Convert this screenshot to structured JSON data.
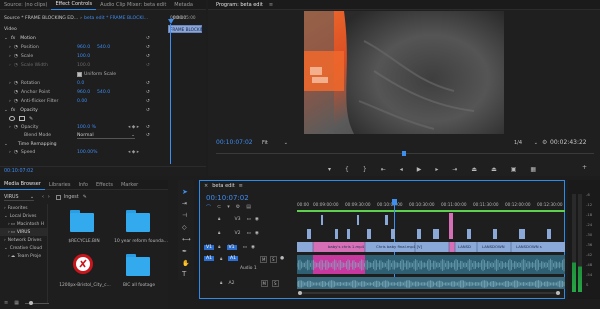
{
  "effect_controls": {
    "tabs": [
      "Source: (no clips)",
      "Effect Controls",
      "Audio Clip Mixer: beta edit",
      "Metada"
    ],
    "source_label": "Source * FRAME BLOCKING ED...",
    "sequence_label": "beta edit * FRAME BLOCKI...",
    "timecode_start": "00:00",
    "timecode_end": "00:00:05:00",
    "clip_label": "FRAME BLOCKING ED",
    "video_header": "Video",
    "motion_label": "Motion",
    "properties": [
      {
        "name": "Position",
        "value": "960.0",
        "value2": "540.0"
      },
      {
        "name": "Scale",
        "value": "100.0",
        "value2": ""
      },
      {
        "name": "Scale Width",
        "value": "100.0",
        "value2": ""
      },
      {
        "name": "Uniform Scale",
        "value": "",
        "value2": ""
      },
      {
        "name": "Rotation",
        "value": "0.0",
        "value2": ""
      },
      {
        "name": "Anchor Point",
        "value": "960.0",
        "value2": "540.0"
      },
      {
        "name": "Anti-flicker Filter",
        "value": "0.00",
        "value2": ""
      }
    ],
    "opacity_label": "Opacity",
    "opacity_value": "100.0 %",
    "blend_mode_label": "Blend Mode",
    "blend_mode_value": "Normal",
    "time_remapping_label": "Time Remapping",
    "speed_label": "Speed",
    "speed_value": "100.00%",
    "footer_timecode": "00:10:07:02"
  },
  "program": {
    "title": "Program: beta edit",
    "timecode": "00:10:07:02",
    "fit": "Fit",
    "fraction": "1/4",
    "duration": "00:02:43:22"
  },
  "media_browser": {
    "tabs": [
      "Media Browser",
      "Libraries",
      "Info",
      "Effects",
      "Marker"
    ],
    "drive": "VIRUS",
    "ingest": "Ingest",
    "tree": [
      "Favorites",
      "Local Drives",
      "Macintosh H",
      "VIRUS",
      "Network Drives",
      "Creative Cloud",
      "Team Proje"
    ],
    "items": [
      {
        "name": "$RECYCLE.BIN",
        "kind": "folder"
      },
      {
        "name": "10 year reform founda...",
        "kind": "folder"
      },
      {
        "name": "1200px-Bristol_City_c...",
        "kind": "image"
      },
      {
        "name": "BIC all footage",
        "kind": "folder"
      }
    ]
  },
  "timeline": {
    "tab": "beta edit",
    "timecode": "00:10:07:02",
    "ruler": [
      "00:00",
      "00:09:00:00",
      "00:09:30:00",
      "00:10:00:00",
      "00:10:30:00",
      "00:11:00:00",
      "00:11:30:00",
      "00:12:00:00",
      "00:12:30:00"
    ],
    "tracks": [
      {
        "name": "V3"
      },
      {
        "name": "V2"
      },
      {
        "name": "V1",
        "target": "V1"
      },
      {
        "name": "A1",
        "target": "A1",
        "label": "Audio 1"
      },
      {
        "name": "A2"
      }
    ],
    "clip_labels": [
      "baby's chris 1.mp4",
      "Chris baby final.mp4 [V]",
      "LANSD",
      "LANSDOWN",
      "LANSDOWN s"
    ]
  },
  "meter_labels": [
    "-6",
    "-12",
    "-18",
    "-24",
    "-30",
    "-36",
    "-42",
    "-48",
    "-54",
    "S"
  ],
  "colors": {
    "accent": "#2d8ceb",
    "magenta": "#d03ab5",
    "pink": "#d66fb6",
    "clip_blue": "#8aa8d8",
    "audio_teal": "#2f5f72",
    "folder": "#2fa6e6"
  }
}
